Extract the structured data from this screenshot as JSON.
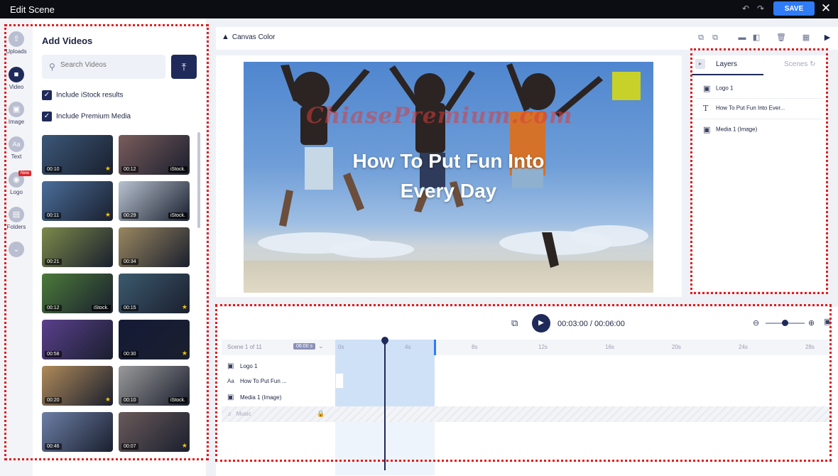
{
  "window": {
    "title": "Edit Scene",
    "save_label": "SAVE"
  },
  "rail": [
    {
      "name": "uploads",
      "label": "Uploads"
    },
    {
      "name": "video",
      "label": "Video"
    },
    {
      "name": "image",
      "label": "Image"
    },
    {
      "name": "text",
      "label": "Text"
    },
    {
      "name": "logo",
      "label": "Logo",
      "badge": "New"
    },
    {
      "name": "folders",
      "label": "Folders"
    }
  ],
  "left_panel": {
    "heading": "Add Videos",
    "search_placeholder": "Search Videos",
    "check_istock": "Include iStock results",
    "check_premium": "Include Premium Media",
    "thumbs": [
      {
        "dur": "00:10",
        "badge": "star",
        "color": "#3b5878"
      },
      {
        "dur": "00:12",
        "badge": "iStock.",
        "color": "#7a5c5c"
      },
      {
        "dur": "00:11",
        "badge": "star",
        "color": "#4a6e9a"
      },
      {
        "dur": "00:29",
        "badge": "iStock.",
        "color": "#b7c2d0"
      },
      {
        "dur": "00:21",
        "badge": "",
        "color": "#7c8a4a"
      },
      {
        "dur": "00:34",
        "badge": "",
        "color": "#9a8760"
      },
      {
        "dur": "00:12",
        "badge": "iStock.",
        "color": "#4c7a3a"
      },
      {
        "dur": "00:15",
        "badge": "star",
        "color": "#3c5a6e"
      },
      {
        "dur": "00:58",
        "badge": "",
        "color": "#5a3f8c"
      },
      {
        "dur": "00:30",
        "badge": "star",
        "color": "#141a36"
      },
      {
        "dur": "00:20",
        "badge": "star",
        "color": "#b08a5a"
      },
      {
        "dur": "00:10",
        "badge": "iStock.",
        "color": "#9a9a9a"
      },
      {
        "dur": "00:46",
        "badge": "",
        "color": "#6d7fa6"
      },
      {
        "dur": "00:07",
        "badge": "star",
        "color": "#6a5a5a"
      }
    ]
  },
  "toolbar": {
    "canvas_color": "Canvas Color"
  },
  "canvas": {
    "watermark": "ChiasePremium.com",
    "headline_line1": "How To Put Fun Into",
    "headline_line2": "Every Day"
  },
  "layers_panel": {
    "tab_layers": "Layers",
    "tab_scenes": "Scenes",
    "items": [
      {
        "icon": "image-icon",
        "label": "Logo 1"
      },
      {
        "icon": "text-icon",
        "label": "How To Put Fun Into Ever..."
      },
      {
        "icon": "image-icon",
        "label": "Media 1 (Image)"
      }
    ]
  },
  "timeline": {
    "timecode": "00:03:00 / 00:06:00",
    "scene_label": "Scene 1 of 11",
    "scene_duration": "06:00 s",
    "ticks": [
      "0s",
      "4s",
      "8s",
      "12s",
      "16s",
      "20s",
      "24s",
      "28s"
    ],
    "tracks": [
      {
        "icon": "image-icon",
        "label": "Logo 1"
      },
      {
        "icon": "text-icon",
        "label": "How To Put Fun ..."
      },
      {
        "icon": "image-icon",
        "label": "Media 1 (Image)"
      }
    ],
    "music_label": "Music"
  }
}
